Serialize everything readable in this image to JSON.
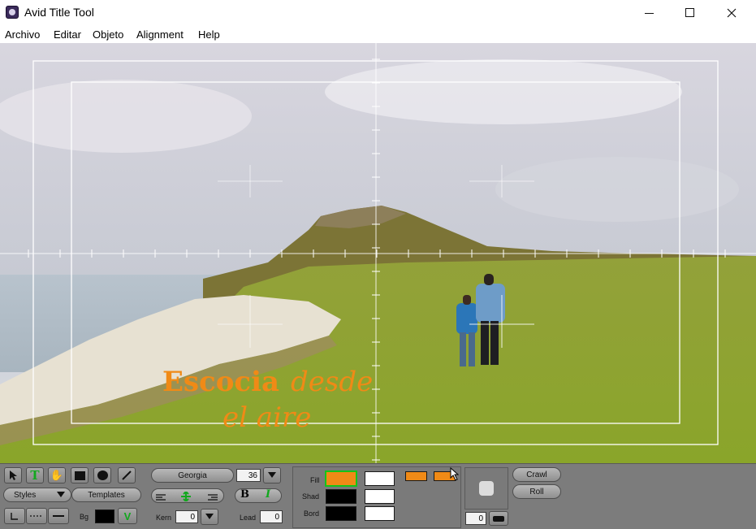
{
  "window": {
    "title": "Avid Title Tool"
  },
  "menu": {
    "items": [
      "Archivo",
      "Editar",
      "Objeto",
      "Alignment",
      "Help"
    ]
  },
  "canvas": {
    "title_text_bold": "Escocia",
    "title_text_italic": "desde",
    "title_text_line2": "el aire",
    "title_color": "#f08a16"
  },
  "toolbar": {
    "tools": [
      "select-arrow-icon",
      "text-tool-icon",
      "hand-icon",
      "rectangle-icon",
      "ellipse-icon",
      "line-icon"
    ],
    "font_name": "Georgia",
    "font_size": "36",
    "styles_label": "Styles",
    "templates_label": "Templates",
    "bold_label": "B",
    "italic_label": "I",
    "bg_label": "Bg",
    "kern_label": "Kern",
    "kern_value": "0",
    "lead_label": "Lead",
    "lead_value": "0",
    "fill_label": "Fill",
    "shad_label": "Shad",
    "bord_label": "Bord",
    "depth_value": "0",
    "crawl_label": "Crawl",
    "roll_label": "Roll",
    "colors": {
      "fill": "#f08a16",
      "shadow": "#000000",
      "border": "#000000",
      "white": "#ffffff",
      "bg": "#000000"
    }
  }
}
